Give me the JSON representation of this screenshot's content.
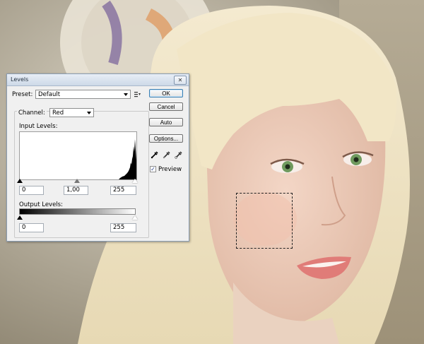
{
  "dialog": {
    "title": "Levels",
    "close_glyph": "✕",
    "preset_label": "Preset:",
    "preset_value": "Default",
    "channel_label": "Channel:",
    "channel_value": "Red",
    "input_levels_label": "Input Levels:",
    "input_black": "0",
    "input_gamma": "1,00",
    "input_white": "255",
    "output_levels_label": "Output Levels:",
    "output_black": "0",
    "output_white": "255",
    "buttons": {
      "ok": "OK",
      "cancel": "Cancel",
      "auto": "Auto",
      "options": "Options..."
    },
    "preview_label": "Preview",
    "preview_checked": true,
    "check_glyph": "✓",
    "icons": [
      "preset-menu-icon",
      "black-eyedropper-icon",
      "gray-eyedropper-icon",
      "white-eyedropper-icon",
      "close-icon"
    ]
  },
  "colors": {
    "accent": "#3c7fb1",
    "dialog_bg": "#f0f0f0",
    "titlebar": "#cdd9e8"
  }
}
